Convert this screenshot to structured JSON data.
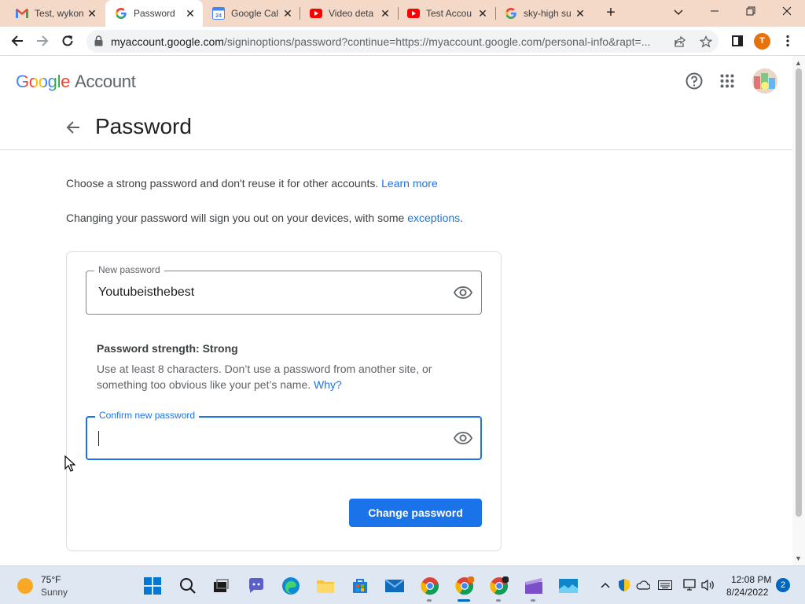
{
  "browser": {
    "tabs": [
      {
        "title": "Test, wykon",
        "icon": "gmail-icon"
      },
      {
        "title": "Password",
        "icon": "google-icon",
        "active": true
      },
      {
        "title": "Google Cal",
        "icon": "google-calendar-icon"
      },
      {
        "title": "Video deta",
        "icon": "youtube-icon"
      },
      {
        "title": "Test Accou",
        "icon": "youtube-icon"
      },
      {
        "title": "sky-high su",
        "icon": "google-icon"
      }
    ],
    "url_host": "myaccount.google.com",
    "url_path": "/signinoptions/password?continue=https://myaccount.google.com/personal-info&rapt=...",
    "profile_initial": "T"
  },
  "header": {
    "logo_google": "Google",
    "logo_account": "Account"
  },
  "page": {
    "title": "Password",
    "intro_text": "Choose a strong password and don't reuse it for other accounts.",
    "intro_link": "Learn more",
    "signout_text": "Changing your password will sign you out on your devices, with some",
    "signout_link": "exceptions",
    "signout_end": "."
  },
  "form": {
    "new_password_label": "New password",
    "new_password_value": "Youtubeisthebest",
    "strength_label": "Password strength: Strong",
    "hint_text": "Use at least 8 characters. Don’t use a password from another site, or something too obvious like your pet’s name.",
    "hint_link": "Why?",
    "confirm_label": "Confirm new password",
    "confirm_value": "",
    "submit_label": "Change password"
  },
  "taskbar": {
    "weather_temp": "75°F",
    "weather_condition": "Sunny",
    "time": "12:08 PM",
    "date": "8/24/2022",
    "notification_count": "2"
  },
  "colors": {
    "accent": "#1a73e8",
    "tabstrip": "#f4d8c8",
    "taskbar": "#dfe7f3"
  }
}
